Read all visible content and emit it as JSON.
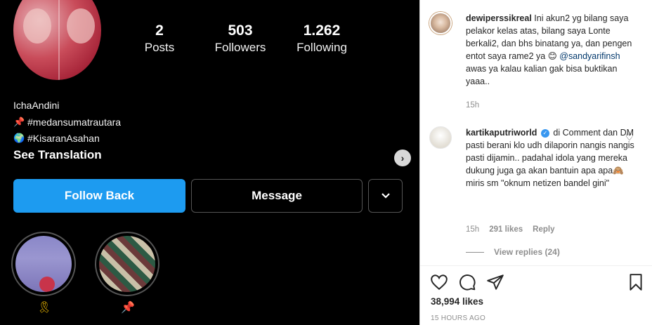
{
  "profile": {
    "stats": [
      {
        "value": "2",
        "label": "Posts"
      },
      {
        "value": "503",
        "label": "Followers"
      },
      {
        "value": "1.262",
        "label": "Following"
      }
    ],
    "username": "IchaAndini",
    "bio_lines": [
      {
        "icon": "pushpin-icon",
        "text": "#medansumatrautara"
      },
      {
        "icon": "globe-icon",
        "text": "#KisaranAsahan"
      }
    ],
    "see_translation": "See Translation",
    "follow_back_label": "Follow Back",
    "message_label": "Message",
    "highlights": [
      {
        "label_icon": "🎗"
      },
      {
        "label_icon": "📌"
      }
    ]
  },
  "post": {
    "caption": {
      "username": "dewiperssikreal",
      "text_part1": "Ini akun2 yg bilang saya pelakor kelas atas, bilang saya Lonte berkali2, dan bhs binatang ya, dan pengen entot saya rame2 ya 😊",
      "mention": "@sandyarifinsh",
      "text_part2": "awas ya kalau kalian gak bisa buktikan yaaa..",
      "time": "15h"
    },
    "comment": {
      "username": "kartikaputriworld",
      "text": "di Comment dan DM pasti berani klo udh dilaporin nangis nangis pasti dijamin.. padahal idola yang mereka dukung juga ga akan bantuin apa apa🙈 miris sm \"oknum netizen bandel gini\"",
      "time": "15h",
      "likes": "291 likes",
      "reply": "Reply",
      "view_replies": "View replies (24)"
    },
    "likes_count": "38,994 likes",
    "posted_ago": "15 HOURS AGO"
  }
}
